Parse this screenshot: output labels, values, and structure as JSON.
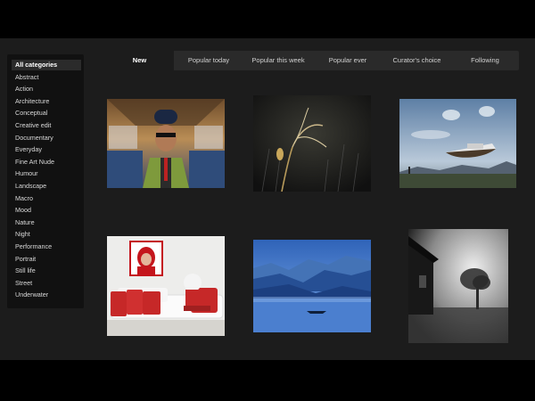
{
  "sidebar": {
    "categories": [
      "All categories",
      "Abstract",
      "Action",
      "Architecture",
      "Conceptual",
      "Creative edit",
      "Documentary",
      "Everyday",
      "Fine Art Nude",
      "Humour",
      "Landscape",
      "Macro",
      "Mood",
      "Nature",
      "Night",
      "Performance",
      "Portrait",
      "Still life",
      "Street",
      "Underwater"
    ]
  },
  "tabs": [
    "New",
    "Popular today",
    "Popular this week",
    "Popular ever",
    "Curator's choice",
    "Following"
  ],
  "photos": [
    {
      "icon": "portrait-photo"
    },
    {
      "icon": "plant-macro-photo"
    },
    {
      "icon": "flying-boat-photo"
    },
    {
      "icon": "red-sofa-photo"
    },
    {
      "icon": "blue-mountains-photo"
    },
    {
      "icon": "house-tree-photo"
    }
  ]
}
